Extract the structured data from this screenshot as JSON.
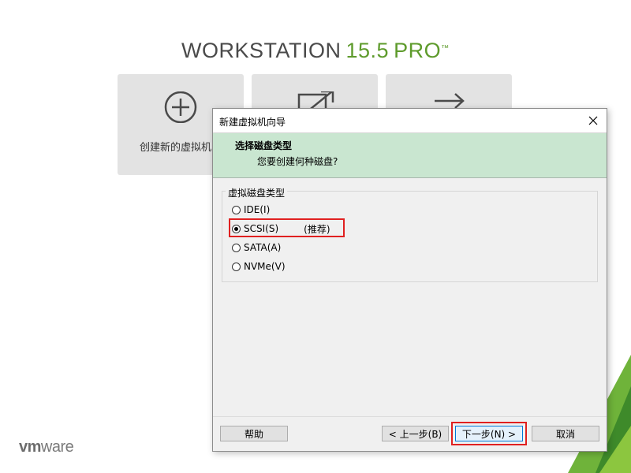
{
  "home": {
    "brand_word": "WORKSTATION",
    "brand_version": "15.5",
    "brand_edition": "PRO",
    "brand_tm": "™",
    "tile_create_label": "创建新的虚拟机",
    "vendor_logo_bold": "vm",
    "vendor_logo_rest": "ware"
  },
  "dialog": {
    "window_title": "新建虚拟机向导",
    "header_title": "选择磁盘类型",
    "header_subtitle": "您要创建何种磁盘?",
    "group_title": "虚拟磁盘类型",
    "options": [
      {
        "label": "IDE(I)",
        "checked": false
      },
      {
        "label": "SCSI(S)",
        "checked": true,
        "note": "(推荐)"
      },
      {
        "label": "SATA(A)",
        "checked": false
      },
      {
        "label": "NVMe(V)",
        "checked": false
      }
    ],
    "buttons": {
      "help": "帮助",
      "back": "< 上一步(B)",
      "next": "下一步(N) >",
      "cancel": "取消"
    }
  },
  "colors": {
    "header_bg": "#c9e6d0",
    "brand_green": "#5e9b2c",
    "highlight_red": "#e02020"
  }
}
